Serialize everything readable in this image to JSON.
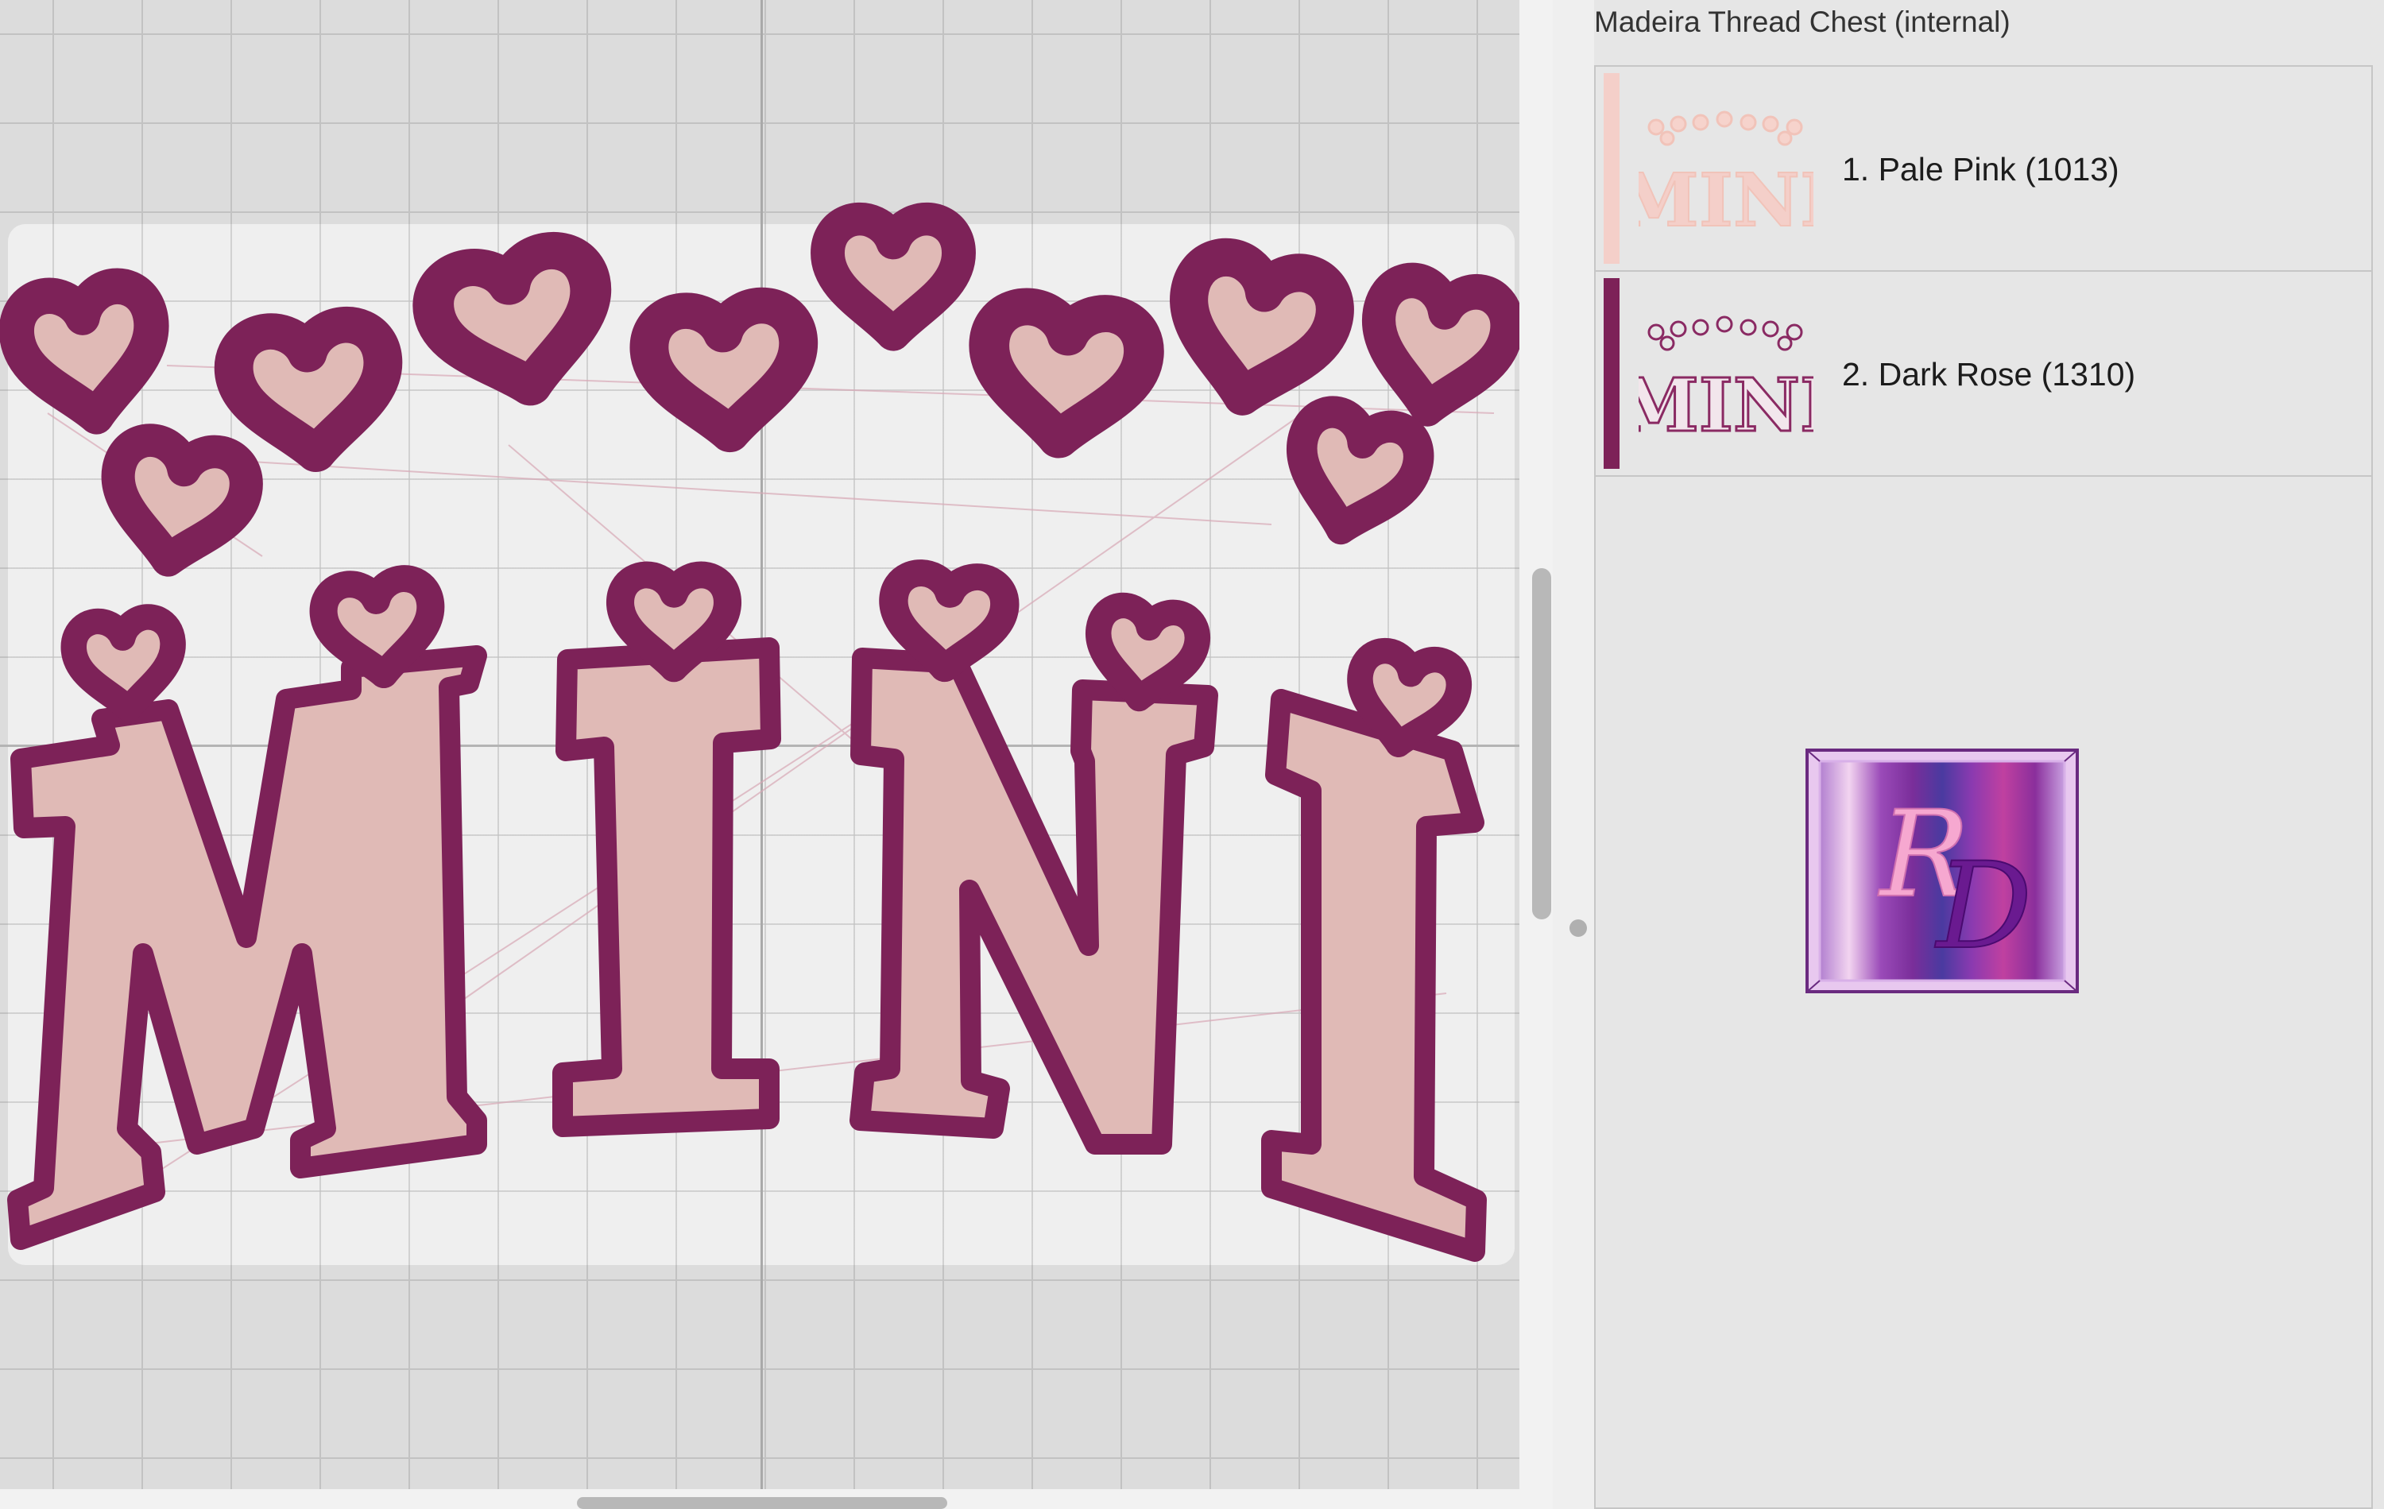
{
  "panel": {
    "title": "Madeira Thread Chest (internal)"
  },
  "threads": [
    {
      "label": "1. Pale Pink (1013)",
      "color": "#f4cfc9"
    },
    {
      "label": "2. Dark Rose (1310)",
      "color": "#7d2258"
    }
  ],
  "design": {
    "text": "MINI",
    "fill_color": "#e0bab6",
    "outline_color": "#7d2258",
    "logo_letters": "RD"
  },
  "colors": {
    "canvas_bg": "#dcdcdc",
    "panel_bg": "#e6e6e6",
    "row_border": "#c6c6c6"
  }
}
